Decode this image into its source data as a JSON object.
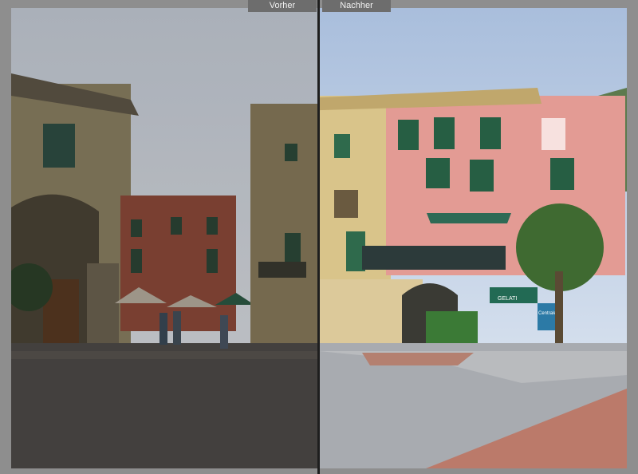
{
  "compare_view": {
    "before_label": "Vorher",
    "after_label": "Nachher"
  },
  "scene": {
    "cafe_sign": "GELATI",
    "shop_sign": "Centrale"
  },
  "colors": {
    "frame": "#8e8e8e",
    "label_bg": "#6d6d6d",
    "divider": "#1e1e1e"
  }
}
